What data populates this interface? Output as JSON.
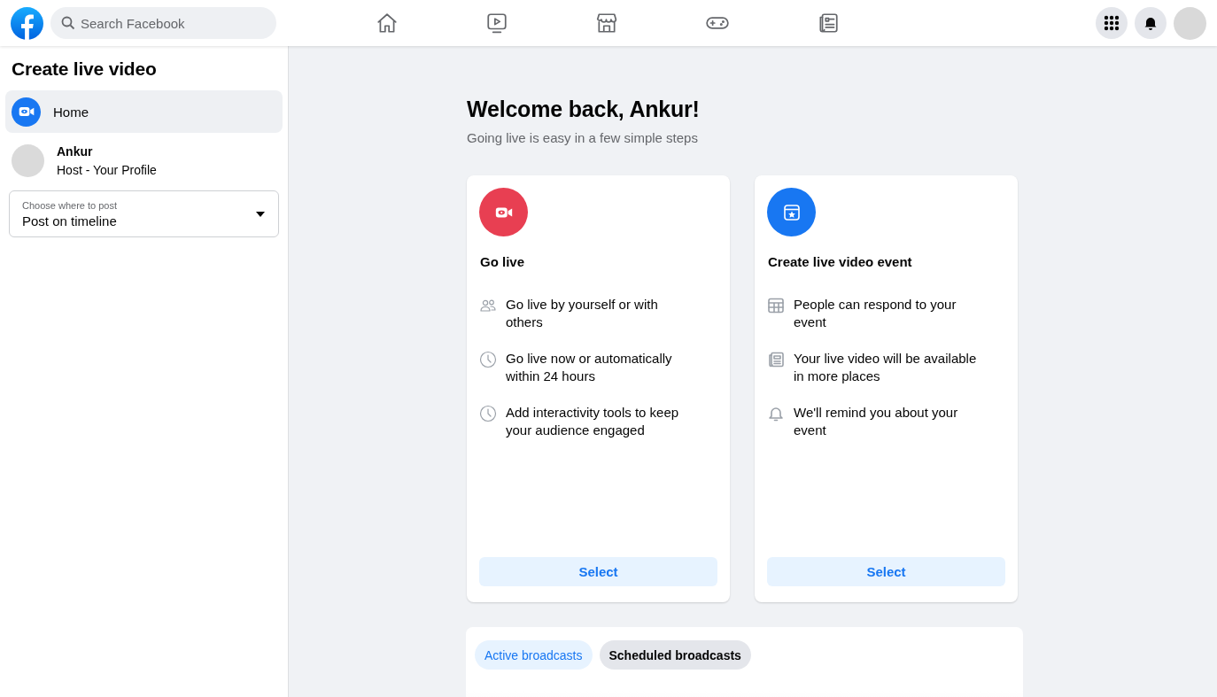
{
  "search": {
    "placeholder": "Search Facebook"
  },
  "sidebar": {
    "title": "Create live video",
    "items": [
      {
        "kind": "video",
        "label": "Home",
        "selected": true
      },
      {
        "kind": "profile",
        "label": "Ankur",
        "sublabel": "Host - Your Profile",
        "selected": false
      }
    ],
    "post_select": {
      "label": "Choose where to post",
      "value": "Post on timeline"
    }
  },
  "welcome": {
    "title": "Welcome back, Ankur!",
    "subtitle": "Going live is easy in a few simple steps"
  },
  "cards": [
    {
      "kind": "live",
      "title": "Go live",
      "features": [
        {
          "kind": "people",
          "text": "Go live by yourself or with others"
        },
        {
          "kind": "clock",
          "text": "Go live now or automatically within 24 hours"
        },
        {
          "kind": "clock",
          "text": "Add interactivity tools to keep your audience engaged"
        }
      ],
      "button": "Select"
    },
    {
      "kind": "event",
      "title": "Create live video event",
      "features": [
        {
          "kind": "calendar",
          "text": "People can respond to your event"
        },
        {
          "kind": "news",
          "text": "Your live video will be available in more places"
        },
        {
          "kind": "bell",
          "text": "We'll remind you about your event"
        }
      ],
      "button": "Select"
    }
  ],
  "broadcast_tabs": [
    {
      "label": "Active broadcasts",
      "selected": true
    },
    {
      "label": "Scheduled broadcasts",
      "selected": false
    }
  ]
}
